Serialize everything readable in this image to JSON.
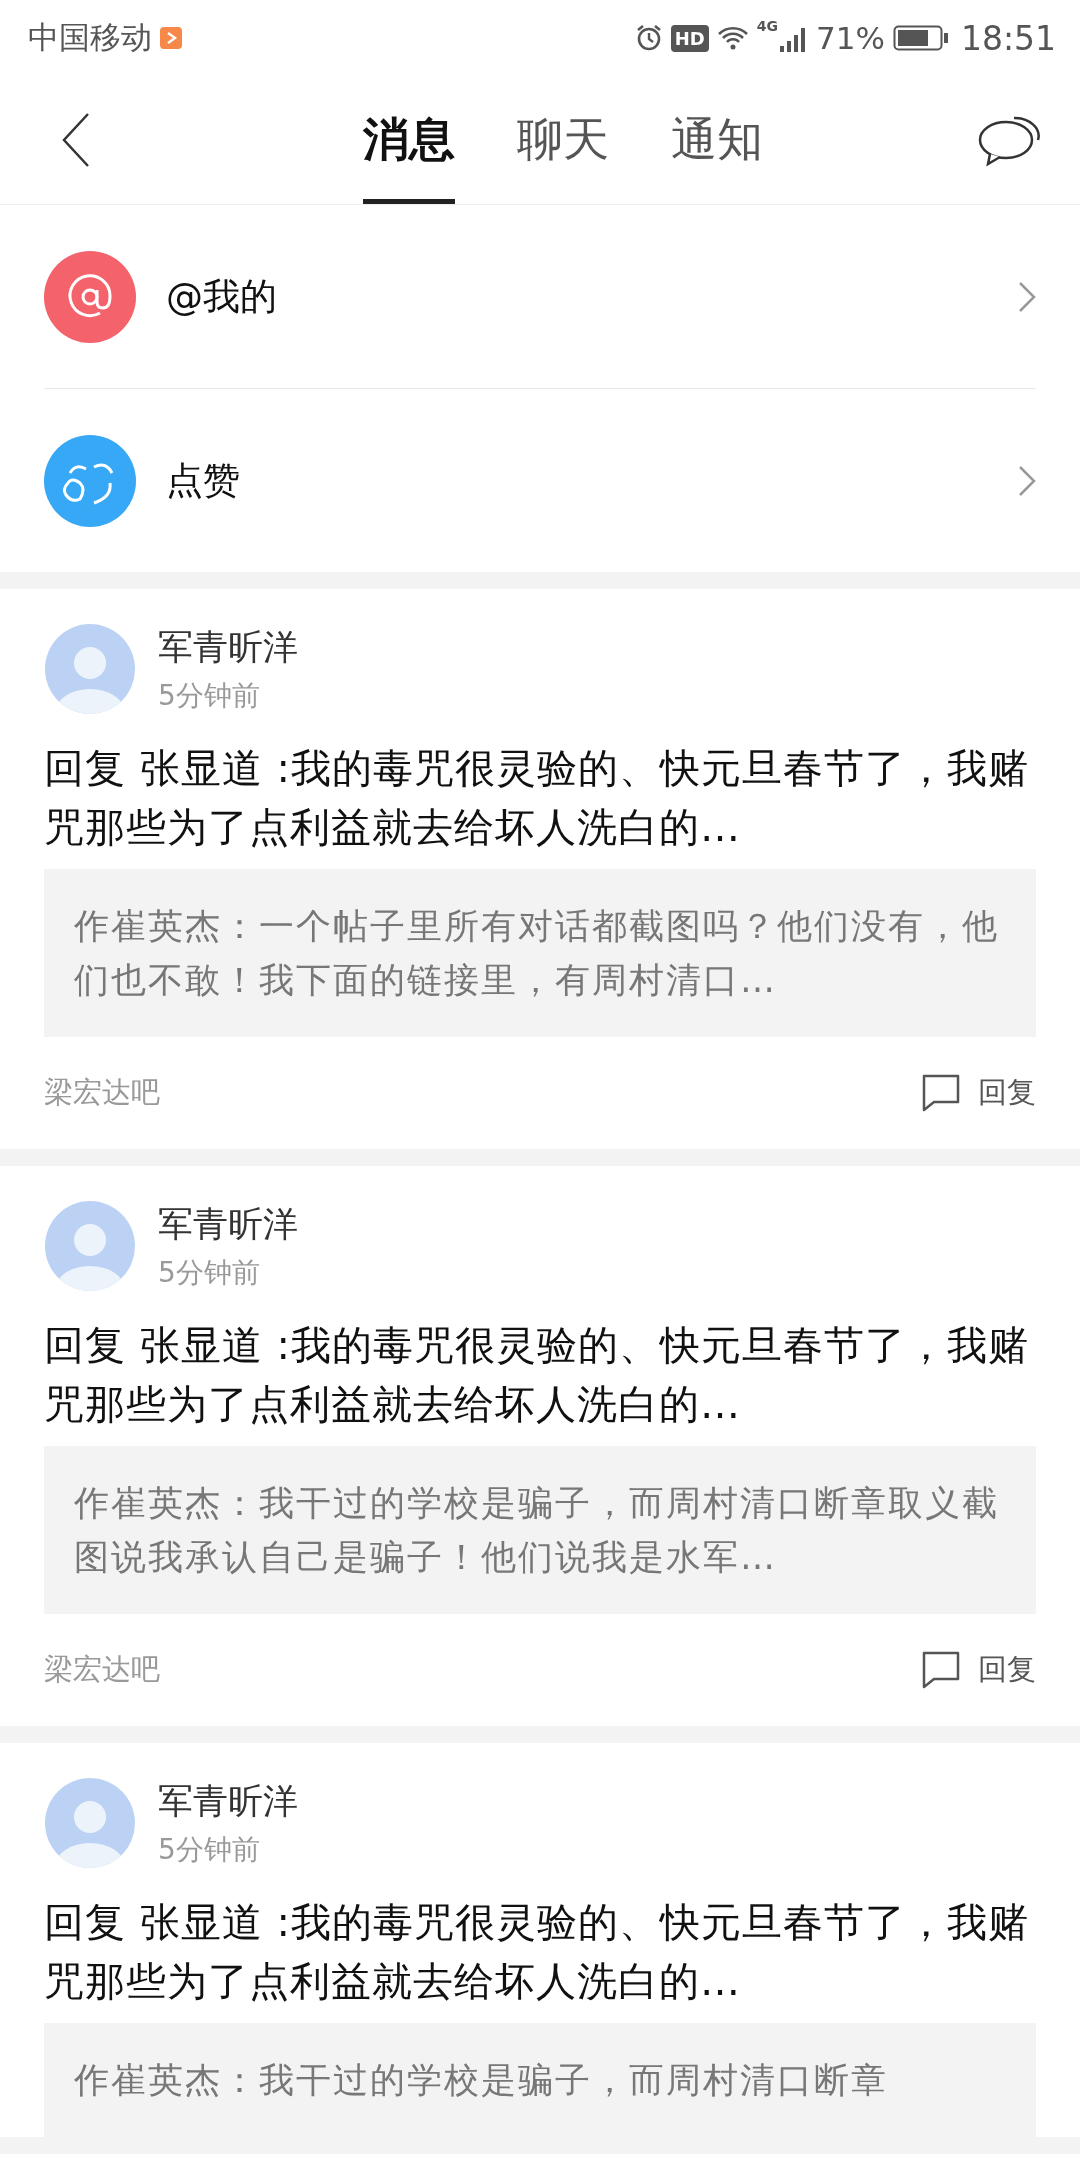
{
  "status_bar": {
    "carrier": "中国移动",
    "hd": "HD",
    "network": "4G",
    "battery": "71%",
    "time": "18:51"
  },
  "tabs": [
    {
      "label": "消息",
      "selected": true
    },
    {
      "label": "聊天",
      "selected": false
    },
    {
      "label": "通知",
      "selected": false
    }
  ],
  "menu": [
    {
      "kind": "mention",
      "label": "@我的"
    },
    {
      "kind": "like",
      "label": "点赞"
    }
  ],
  "cards": [
    {
      "user": "军青昕洋",
      "time": "5分钟前",
      "content": "回复 张显道 :我的毒咒很灵验的、快元旦春节了，我赌咒那些为了点利益就去给坏人洗白的…",
      "quote": "作崔英杰：一个帖子里所有对话都截图吗？他们没有，他们也不敢！我下面的链接里，有周村清口…",
      "forum": "梁宏达吧",
      "reply": "回复"
    },
    {
      "user": "军青昕洋",
      "time": "5分钟前",
      "content": "回复 张显道 :我的毒咒很灵验的、快元旦春节了，我赌咒那些为了点利益就去给坏人洗白的…",
      "quote": "作崔英杰：我干过的学校是骗子，而周村清口断章取义截图说我承认自己是骗子！他们说我是水军…",
      "forum": "梁宏达吧",
      "reply": "回复"
    },
    {
      "user": "军青昕洋",
      "time": "5分钟前",
      "content": "回复 张显道 :我的毒咒很灵验的、快元旦春节了，我赌咒那些为了点利益就去给坏人洗白的…",
      "quote": "作崔英杰：我干过的学校是骗子，而周村清口断章"
    }
  ]
}
